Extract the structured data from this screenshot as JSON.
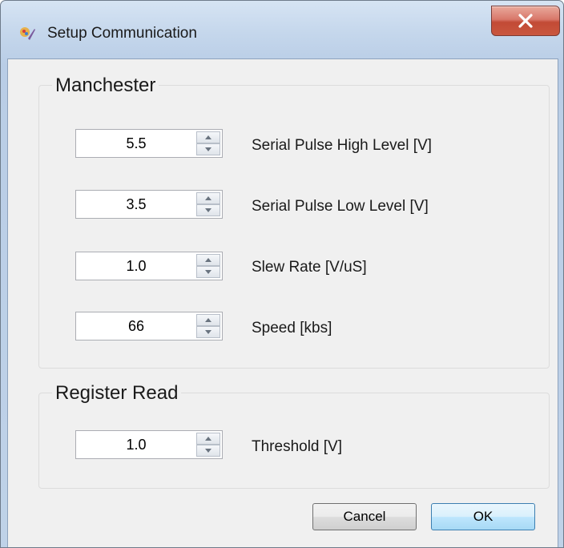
{
  "window": {
    "title": "Setup Communication",
    "close_glyph": "x"
  },
  "groups": {
    "manchester": {
      "label": "Manchester",
      "fields": [
        {
          "value": "5.5",
          "label": "Serial Pulse High Level [V]"
        },
        {
          "value": "3.5",
          "label": "Serial Pulse Low Level [V]"
        },
        {
          "value": "1.0",
          "label": "Slew Rate [V/uS]"
        },
        {
          "value": "66",
          "label": "Speed [kbs]"
        }
      ]
    },
    "register_read": {
      "label": "Register Read",
      "fields": [
        {
          "value": "1.0",
          "label": "Threshold [V]"
        }
      ]
    }
  },
  "buttons": {
    "cancel": "Cancel",
    "ok": "OK"
  },
  "icons": {
    "app": "app-icon",
    "close": "close-icon",
    "spin_up": "chevron-up-icon",
    "spin_down": "chevron-down-icon"
  },
  "colors": {
    "close_button": "#c9573f",
    "ok_border": "#3c7fb1",
    "frame": "#bfd2e8"
  }
}
